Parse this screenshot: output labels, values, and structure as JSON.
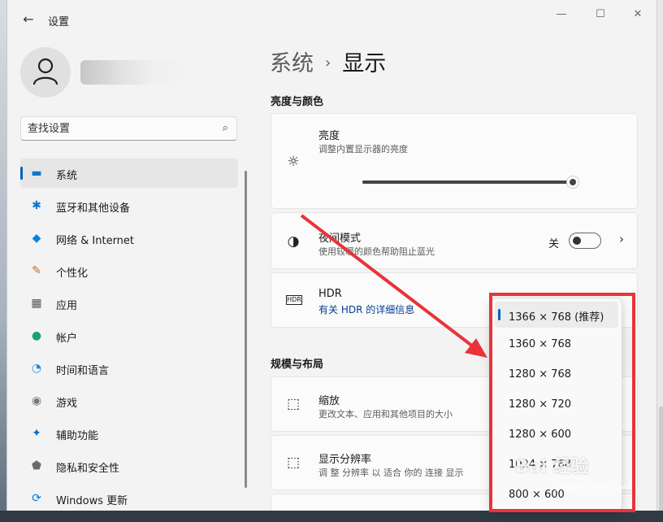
{
  "window": {
    "title": "设置",
    "back_glyph": "←"
  },
  "window_controls": {
    "minimize": "—",
    "maximize": "☐",
    "close": "✕"
  },
  "search": {
    "placeholder": "查找设置",
    "icon": "search-icon",
    "icon_glyph": "⌕"
  },
  "sidebar": {
    "items": [
      {
        "label": "系统",
        "icon": "monitor-icon",
        "glyph": "▬",
        "color": "#0078d4",
        "active": true
      },
      {
        "label": "蓝牙和其他设备",
        "icon": "bluetooth-icon",
        "glyph": "✱",
        "color": "#0078d4"
      },
      {
        "label": "网络 & Internet",
        "icon": "wifi-icon",
        "glyph": "◆",
        "color": "#0a84d6"
      },
      {
        "label": "个性化",
        "icon": "brush-icon",
        "glyph": "✎",
        "color": "#c86a2a"
      },
      {
        "label": "应用",
        "icon": "apps-icon",
        "glyph": "▦",
        "color": "#555555"
      },
      {
        "label": "帐户",
        "icon": "account-icon",
        "glyph": "●",
        "color": "#1aa36a"
      },
      {
        "label": "时间和语言",
        "icon": "globe-clock-icon",
        "glyph": "◔",
        "color": "#2b88d8"
      },
      {
        "label": "游戏",
        "icon": "gamepad-icon",
        "glyph": "◉",
        "color": "#777777"
      },
      {
        "label": "辅助功能",
        "icon": "accessibility-icon",
        "glyph": "✦",
        "color": "#0a6cc2"
      },
      {
        "label": "隐私和安全性",
        "icon": "shield-icon",
        "glyph": "⬟",
        "color": "#6b6b6b"
      },
      {
        "label": "Windows 更新",
        "icon": "update-icon",
        "glyph": "⟳",
        "color": "#0078d4"
      }
    ]
  },
  "breadcrumb": {
    "parent": "系统",
    "separator": "›",
    "current": "显示"
  },
  "sections": {
    "brightness_color": "亮度与颜色",
    "scale_layout": "规模与布局"
  },
  "cards": {
    "brightness": {
      "title": "亮度",
      "subtitle": "调整内置显示器的亮度",
      "icon_glyph": "☼",
      "value": 0.98
    },
    "night_light": {
      "title": "夜间模式",
      "subtitle": "使用较暖的颜色帮助阻止蓝光",
      "state_label": "关",
      "icon_glyph": "◑",
      "chevron": "›"
    },
    "hdr": {
      "title": "HDR",
      "link": "有关 HDR 的详细信息",
      "icon_glyph": "HDR"
    },
    "scale": {
      "title": "缩放",
      "subtitle": "更改文本、应用和其他项目的大小",
      "icon_glyph": "⬚"
    },
    "resolution": {
      "title": "显示分辨率",
      "subtitle": "调 整 分辨率 以 适合 你的 连接 显示",
      "icon_glyph": "⬚"
    }
  },
  "resolution_dropdown": {
    "options": [
      "1366 × 768 (推荐)",
      "1360 × 768",
      "1280 × 768",
      "1280 × 720",
      "1280 × 600",
      "1024 × 768",
      "800 × 600"
    ],
    "selected_index": 0
  },
  "annotation": {
    "color": "#e8343a"
  },
  "watermark": {
    "text": "Bai 经验",
    "sub": "jingyan.baidu.com"
  }
}
